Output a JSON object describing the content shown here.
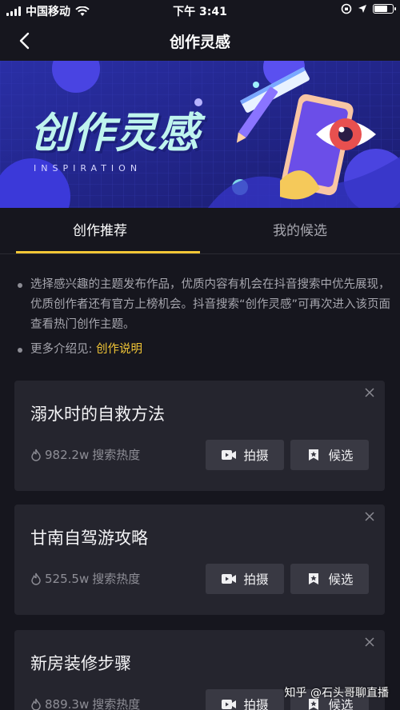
{
  "status_bar": {
    "carrier": "中国移动",
    "time": "下午 3:41"
  },
  "nav": {
    "title": "创作灵感",
    "back_icon": "chevron-left-icon"
  },
  "banner": {
    "title": "创作灵感",
    "subtitle": "INSPIRATION"
  },
  "tabs": [
    {
      "label": "创作推荐",
      "active": true
    },
    {
      "label": "我的候选",
      "active": false
    }
  ],
  "info": {
    "paragraph": "选择感兴趣的主题发布作品，优质内容有机会在抖音搜索中优先展现，优质创作者还有官方上榜机会。抖音搜索“创作灵感”可再次进入该页面查看热门创作主题。",
    "more_prefix": "更多介绍见: ",
    "more_link": "创作说明"
  },
  "cards": [
    {
      "title": "溺水时的自救方法",
      "heat": "982.2w",
      "heat_label": "搜索热度",
      "shoot_label": "拍摄",
      "candidate_label": "候选"
    },
    {
      "title": "甘南自驾游攻略",
      "heat": "525.5w",
      "heat_label": "搜索热度",
      "shoot_label": "拍摄",
      "candidate_label": "候选"
    },
    {
      "title": "新房装修步骤",
      "heat": "889.3w",
      "heat_label": "搜索热度",
      "shoot_label": "拍摄",
      "candidate_label": "候选"
    }
  ],
  "watermark": "知乎 @石头哥聊直播",
  "colors": {
    "background": "#16161e",
    "card": "#25252e",
    "accent": "#f2c636",
    "button": "#393943"
  }
}
